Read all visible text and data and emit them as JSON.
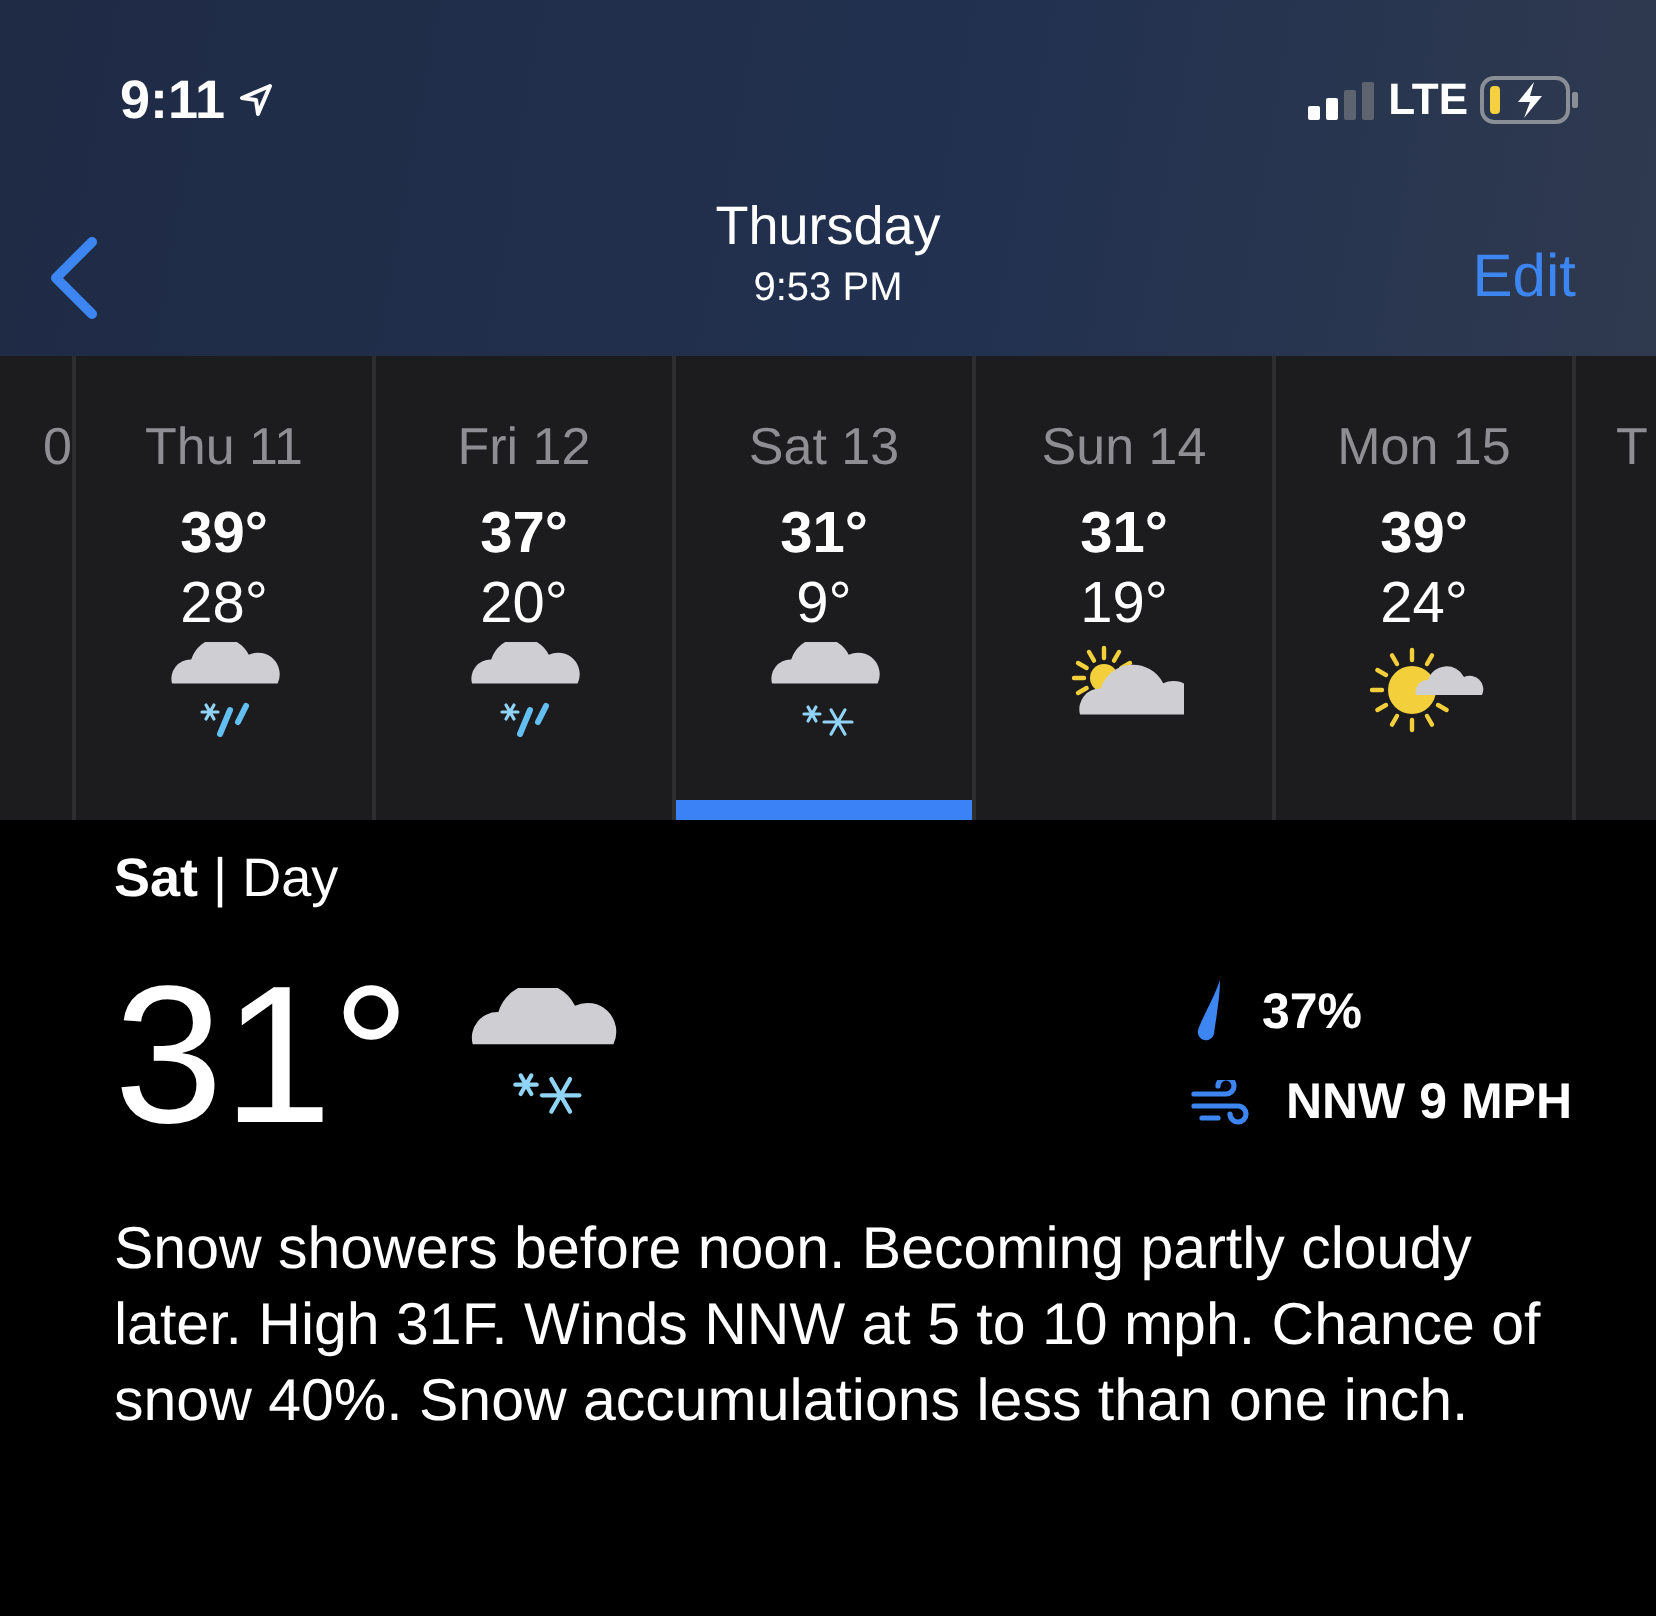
{
  "status_bar": {
    "time": "9:11",
    "network": "LTE"
  },
  "nav": {
    "title": "Thursday",
    "subtitle": "9:53 PM",
    "action": "Edit"
  },
  "days": [
    {
      "kind": "edge",
      "label": "0"
    },
    {
      "kind": "rain-snow",
      "label": "Thu 11",
      "high": "39°",
      "low": "28°",
      "selected": false
    },
    {
      "kind": "rain-snow",
      "label": "Fri 12",
      "high": "37°",
      "low": "20°",
      "selected": false
    },
    {
      "kind": "snow",
      "label": "Sat 13",
      "high": "31°",
      "low": "9°",
      "selected": true
    },
    {
      "kind": "partly-cloudy",
      "label": "Sun 14",
      "high": "31°",
      "low": "19°",
      "selected": false
    },
    {
      "kind": "mostly-sunny",
      "label": "Mon 15",
      "high": "39°",
      "low": "24°",
      "selected": false
    },
    {
      "kind": "edge",
      "label": "T"
    }
  ],
  "detail": {
    "day": "Sat",
    "separator": "|",
    "period": "Day",
    "temp": "31°",
    "kind": "snow",
    "precip": "37%",
    "wind": "NNW 9 MPH",
    "description": "Snow showers before noon. Becoming partly cloudy later. High 31F. Winds NNW at 5 to 10 mph. Chance of snow 40%. Snow accumulations less than one inch."
  }
}
